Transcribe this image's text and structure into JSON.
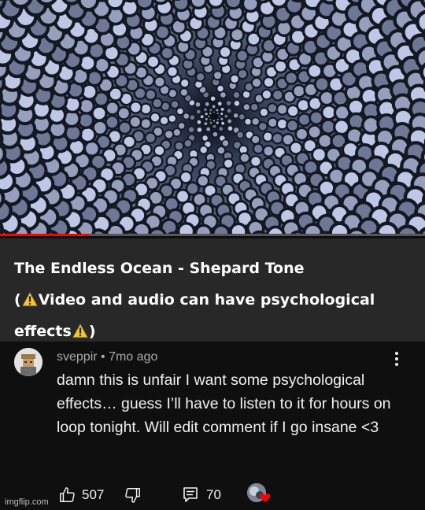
{
  "video": {
    "progress_fraction": 0.21,
    "thumbnail_icon": "fractal-spiral-image",
    "colors": {
      "progress": "#ff0000",
      "track": "#565656"
    }
  },
  "title": {
    "line1": "The Endless Ocean - Shepard Tone",
    "open_paren": "(",
    "middle": "Video and audio can have psychological effects",
    "close_paren": ")",
    "warning_icon": "warning-icon"
  },
  "comment": {
    "author": "sveppir",
    "separator": " • ",
    "age": "7mo ago",
    "text": "damn this is unfair I want some psychological effects… guess I’ll have to listen to it for hours on loop tonight. Will edit comment if I go insane <3",
    "likes": "507",
    "replies": "70",
    "icons": [
      "thumbs-up-icon",
      "thumbs-down-icon",
      "reply-icon",
      "more-vert-icon",
      "heart-icon"
    ],
    "heart_color": "#ff0000"
  },
  "watermark": "imgflip.com"
}
